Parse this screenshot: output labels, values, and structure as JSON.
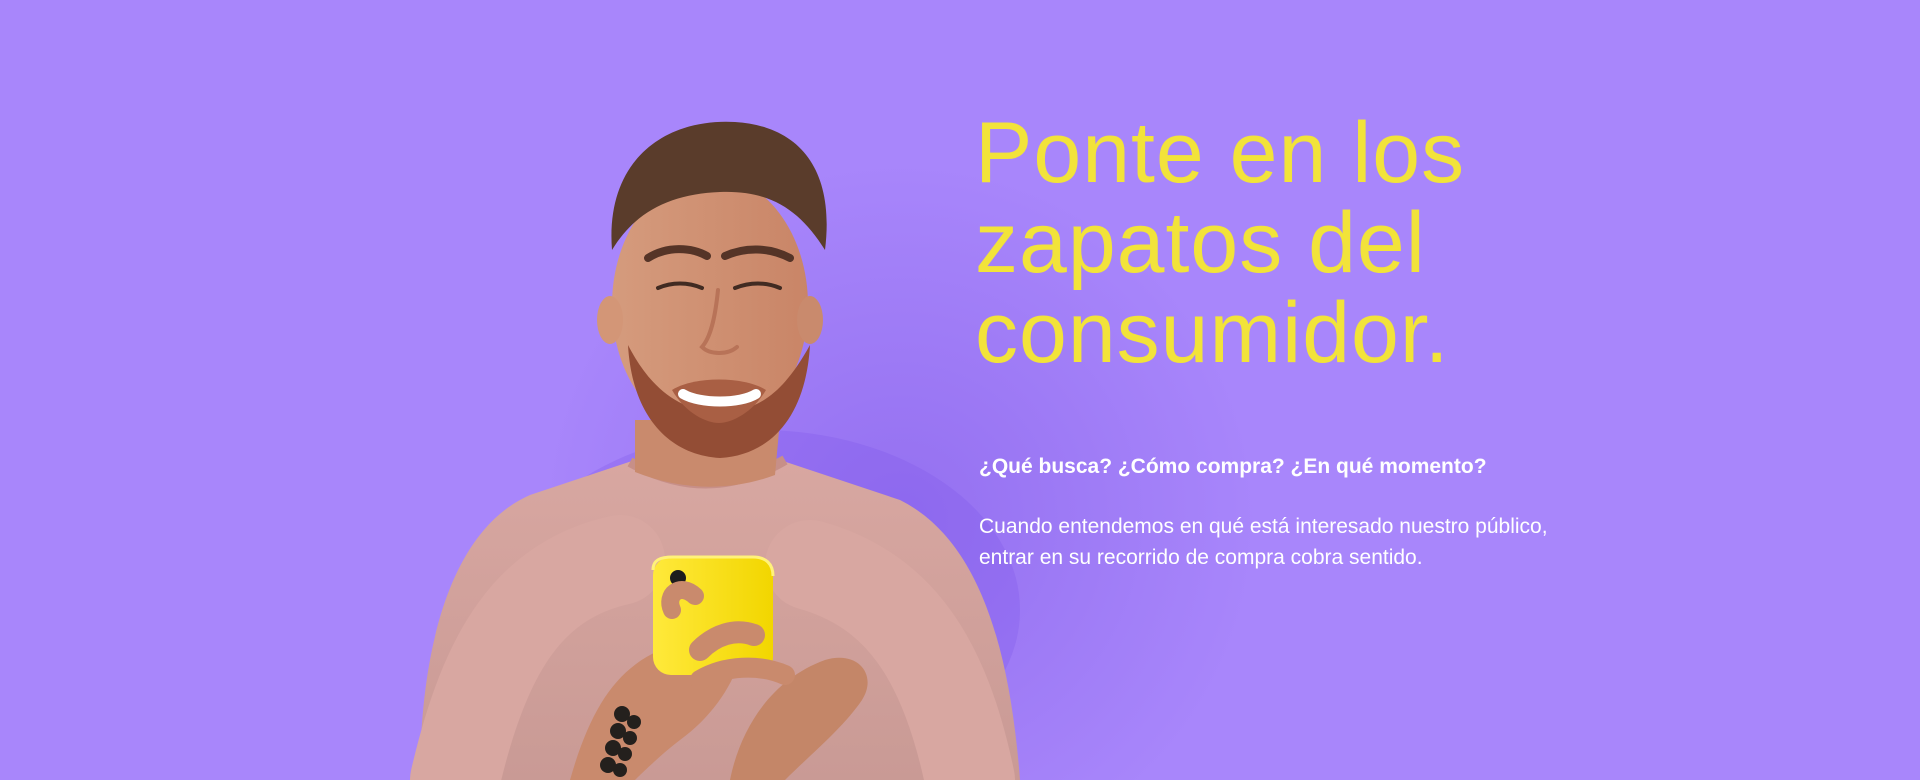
{
  "hero": {
    "background_color": "#a886fb",
    "accent_color": "#f2e33a",
    "headline_lines": [
      "Ponte en los",
      "zapatos del",
      "consumidor."
    ],
    "subheading": "¿Qué busca? ¿Cómo compra? ¿En qué momento?",
    "body": "Cuando entendemos en qué está interesado nuestro público, entrar en su recorrido de compra cobra sentido.",
    "image_subject": "smiling bearded man in pink t-shirt holding yellow smartphone"
  }
}
